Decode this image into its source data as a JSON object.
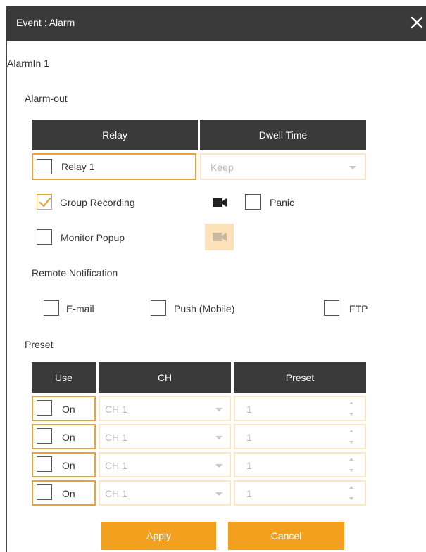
{
  "title": "Event : Alarm",
  "alarm_in_label": "AlarmIn 1",
  "alarm_out": {
    "section_label": "Alarm-out",
    "col_relay": "Relay",
    "col_dwell": "Dwell Time",
    "relay_label": "Relay 1",
    "dwell_value": "Keep"
  },
  "options": {
    "group_recording": {
      "label": "Group Recording",
      "checked": true
    },
    "panic": {
      "label": "Panic",
      "checked": false
    },
    "monitor_popup": {
      "label": "Monitor Popup",
      "checked": false
    }
  },
  "remote_notification": {
    "section_label": "Remote Notification",
    "email": "E-mail",
    "push": "Push (Mobile)",
    "ftp": "FTP"
  },
  "preset": {
    "section_label": "Preset",
    "col_use": "Use",
    "col_ch": "CH",
    "col_preset": "Preset",
    "rows": [
      {
        "use_label": "On",
        "ch": "CH 1",
        "preset": "1"
      },
      {
        "use_label": "On",
        "ch": "CH 1",
        "preset": "1"
      },
      {
        "use_label": "On",
        "ch": "CH 1",
        "preset": "1"
      },
      {
        "use_label": "On",
        "ch": "CH 1",
        "preset": "1"
      }
    ]
  },
  "buttons": {
    "apply": "Apply",
    "cancel": "Cancel"
  },
  "colors": {
    "accent": "#f3a01f",
    "header": "#3a3a3a",
    "disabled_border": "#fbe6c6"
  },
  "icons": {
    "close": "close-icon",
    "camera": "camera-icon"
  }
}
